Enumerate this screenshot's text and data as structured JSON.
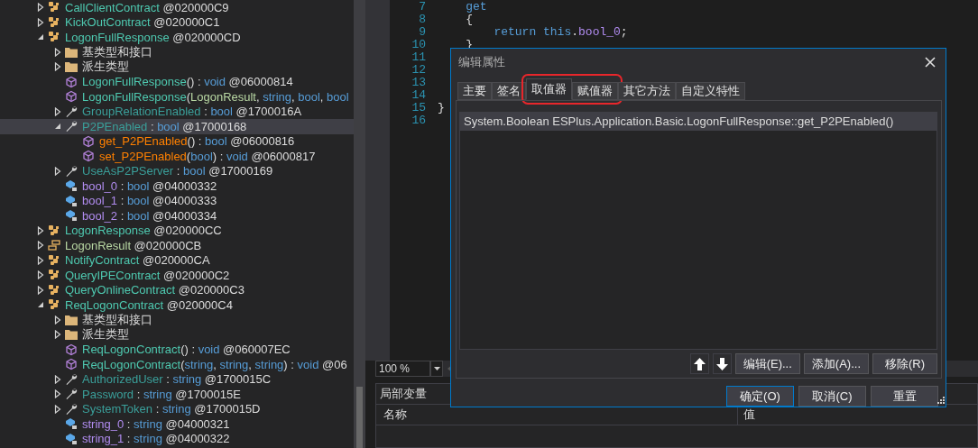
{
  "tree": {
    "items": [
      {
        "kind": "class",
        "expanded": false,
        "selected": false,
        "parts": [
          {
            "text": "CallClientContract",
            "kind": "type"
          },
          {
            "text": " @020000C9",
            "kind": "plain"
          }
        ]
      },
      {
        "kind": "class",
        "expanded": false,
        "selected": false,
        "parts": [
          {
            "text": "KickOutContract",
            "kind": "type"
          },
          {
            "text": " @020000C1",
            "kind": "plain"
          }
        ]
      },
      {
        "kind": "class",
        "expanded": true,
        "selected": false,
        "parts": [
          {
            "text": "LogonFullResponse",
            "kind": "type"
          },
          {
            "text": " @020000CD",
            "kind": "plain"
          }
        ],
        "children": [
          {
            "kind": "folder",
            "expanded": false,
            "selected": false,
            "parts": [
              {
                "text": "基类型和接口",
                "kind": "plain"
              }
            ]
          },
          {
            "kind": "folder",
            "expanded": false,
            "selected": false,
            "parts": [
              {
                "text": "派生类型",
                "kind": "plain"
              }
            ]
          },
          {
            "kind": "method",
            "selected": false,
            "parts": [
              {
                "text": "LogonFullResponse",
                "kind": "type"
              },
              {
                "text": "() : ",
                "kind": "plain"
              },
              {
                "text": "void",
                "kind": "keyword"
              },
              {
                "text": " @06000814",
                "kind": "plain"
              }
            ]
          },
          {
            "kind": "method",
            "selected": false,
            "parts": [
              {
                "text": "LogonFullResponse",
                "kind": "type"
              },
              {
                "text": "(",
                "kind": "plain"
              },
              {
                "text": "LogonResult",
                "kind": "enum"
              },
              {
                "text": ", ",
                "kind": "plain"
              },
              {
                "text": "string",
                "kind": "keyword"
              },
              {
                "text": ", ",
                "kind": "plain"
              },
              {
                "text": "bool",
                "kind": "keyword"
              },
              {
                "text": ", ",
                "kind": "plain"
              },
              {
                "text": "bool",
                "kind": "keyword"
              }
            ]
          },
          {
            "kind": "property",
            "expanded": false,
            "selected": false,
            "parts": [
              {
                "text": "GroupRelationEnabled",
                "kind": "property"
              },
              {
                "text": " : ",
                "kind": "plain"
              },
              {
                "text": "bool",
                "kind": "keyword"
              },
              {
                "text": " @1700016A",
                "kind": "plain"
              }
            ]
          },
          {
            "kind": "property",
            "expanded": true,
            "selected": true,
            "parts": [
              {
                "text": "P2PEnabled",
                "kind": "property"
              },
              {
                "text": " : ",
                "kind": "plain"
              },
              {
                "text": "bool",
                "kind": "keyword"
              },
              {
                "text": " @17000168",
                "kind": "plain"
              }
            ],
            "children": [
              {
                "kind": "method",
                "selected": false,
                "parts": [
                  {
                    "text": "get_P2PEnabled",
                    "kind": "accessor"
                  },
                  {
                    "text": "() : ",
                    "kind": "plain"
                  },
                  {
                    "text": "bool",
                    "kind": "keyword"
                  },
                  {
                    "text": " @06000816",
                    "kind": "plain"
                  }
                ]
              },
              {
                "kind": "method",
                "selected": false,
                "parts": [
                  {
                    "text": "set_P2PEnabled",
                    "kind": "accessor"
                  },
                  {
                    "text": "(",
                    "kind": "plain"
                  },
                  {
                    "text": "bool",
                    "kind": "keyword"
                  },
                  {
                    "text": ") : ",
                    "kind": "plain"
                  },
                  {
                    "text": "void",
                    "kind": "keyword"
                  },
                  {
                    "text": " @06000817",
                    "kind": "plain"
                  }
                ]
              }
            ]
          },
          {
            "kind": "property",
            "expanded": false,
            "selected": false,
            "parts": [
              {
                "text": "UseAsP2PServer",
                "kind": "property"
              },
              {
                "text": " : ",
                "kind": "plain"
              },
              {
                "text": "bool",
                "kind": "keyword"
              },
              {
                "text": " @17000169",
                "kind": "plain"
              }
            ]
          },
          {
            "kind": "field",
            "selected": false,
            "parts": [
              {
                "text": "bool_0",
                "kind": "field"
              },
              {
                "text": " : ",
                "kind": "plain"
              },
              {
                "text": "bool",
                "kind": "keyword"
              },
              {
                "text": " @04000332",
                "kind": "plain"
              }
            ]
          },
          {
            "kind": "field",
            "selected": false,
            "parts": [
              {
                "text": "bool_1",
                "kind": "field"
              },
              {
                "text": " : ",
                "kind": "plain"
              },
              {
                "text": "bool",
                "kind": "keyword"
              },
              {
                "text": " @04000333",
                "kind": "plain"
              }
            ]
          },
          {
            "kind": "field",
            "selected": false,
            "parts": [
              {
                "text": "bool_2",
                "kind": "field"
              },
              {
                "text": " : ",
                "kind": "plain"
              },
              {
                "text": "bool",
                "kind": "keyword"
              },
              {
                "text": " @04000334",
                "kind": "plain"
              }
            ]
          }
        ]
      },
      {
        "kind": "class",
        "expanded": false,
        "selected": false,
        "parts": [
          {
            "text": "LogonResponse",
            "kind": "type"
          },
          {
            "text": " @020000CC",
            "kind": "plain"
          }
        ]
      },
      {
        "kind": "enum",
        "expanded": false,
        "selected": false,
        "parts": [
          {
            "text": "LogonResult",
            "kind": "enum"
          },
          {
            "text": " @020000CB",
            "kind": "plain"
          }
        ]
      },
      {
        "kind": "class",
        "expanded": false,
        "selected": false,
        "parts": [
          {
            "text": "NotifyContract",
            "kind": "type"
          },
          {
            "text": " @020000CA",
            "kind": "plain"
          }
        ]
      },
      {
        "kind": "class",
        "expanded": false,
        "selected": false,
        "parts": [
          {
            "text": "QueryIPEContract",
            "kind": "type"
          },
          {
            "text": " @020000C2",
            "kind": "plain"
          }
        ]
      },
      {
        "kind": "class",
        "expanded": false,
        "selected": false,
        "parts": [
          {
            "text": "QueryOnlineContract",
            "kind": "type"
          },
          {
            "text": " @020000C3",
            "kind": "plain"
          }
        ]
      },
      {
        "kind": "class",
        "expanded": true,
        "selected": false,
        "parts": [
          {
            "text": "ReqLogonContract",
            "kind": "type"
          },
          {
            "text": " @020000C4",
            "kind": "plain"
          }
        ],
        "children": [
          {
            "kind": "folder",
            "expanded": false,
            "selected": false,
            "parts": [
              {
                "text": "基类型和接口",
                "kind": "plain"
              }
            ]
          },
          {
            "kind": "folder",
            "expanded": false,
            "selected": false,
            "parts": [
              {
                "text": "派生类型",
                "kind": "plain"
              }
            ]
          },
          {
            "kind": "method",
            "selected": false,
            "parts": [
              {
                "text": "ReqLogonContract",
                "kind": "type"
              },
              {
                "text": "() : ",
                "kind": "plain"
              },
              {
                "text": "void",
                "kind": "keyword"
              },
              {
                "text": " @060007EC",
                "kind": "plain"
              }
            ]
          },
          {
            "kind": "method",
            "selected": false,
            "parts": [
              {
                "text": "ReqLogonContract",
                "kind": "type"
              },
              {
                "text": "(",
                "kind": "plain"
              },
              {
                "text": "string",
                "kind": "keyword"
              },
              {
                "text": ", ",
                "kind": "plain"
              },
              {
                "text": "string",
                "kind": "keyword"
              },
              {
                "text": ", ",
                "kind": "plain"
              },
              {
                "text": "string",
                "kind": "keyword"
              },
              {
                "text": ") : ",
                "kind": "plain"
              },
              {
                "text": "void",
                "kind": "keyword"
              },
              {
                "text": " @06",
                "kind": "plain"
              }
            ]
          },
          {
            "kind": "property",
            "expanded": false,
            "selected": false,
            "parts": [
              {
                "text": "AuthorizedUser",
                "kind": "property"
              },
              {
                "text": " : ",
                "kind": "plain"
              },
              {
                "text": "string",
                "kind": "keyword"
              },
              {
                "text": " @1700015C",
                "kind": "plain"
              }
            ]
          },
          {
            "kind": "property",
            "expanded": false,
            "selected": false,
            "parts": [
              {
                "text": "Password",
                "kind": "property"
              },
              {
                "text": " : ",
                "kind": "plain"
              },
              {
                "text": "string",
                "kind": "keyword"
              },
              {
                "text": " @1700015E",
                "kind": "plain"
              }
            ]
          },
          {
            "kind": "property",
            "expanded": false,
            "selected": false,
            "parts": [
              {
                "text": "SystemToken",
                "kind": "property"
              },
              {
                "text": " : ",
                "kind": "plain"
              },
              {
                "text": "string",
                "kind": "keyword"
              },
              {
                "text": " @1700015D",
                "kind": "plain"
              }
            ]
          },
          {
            "kind": "field",
            "selected": false,
            "parts": [
              {
                "text": "string_0",
                "kind": "field"
              },
              {
                "text": " : ",
                "kind": "plain"
              },
              {
                "text": "string",
                "kind": "keyword"
              },
              {
                "text": " @04000321",
                "kind": "plain"
              }
            ]
          },
          {
            "kind": "field",
            "selected": false,
            "parts": [
              {
                "text": "string_1",
                "kind": "field"
              },
              {
                "text": " : ",
                "kind": "plain"
              },
              {
                "text": "string",
                "kind": "keyword"
              },
              {
                "text": " @04000322",
                "kind": "plain"
              }
            ]
          }
        ]
      }
    ]
  },
  "editor": {
    "lines": [
      {
        "number": "7",
        "parts": [
          {
            "text": "    get",
            "kind": "keyword"
          }
        ]
      },
      {
        "number": "8",
        "parts": [
          {
            "text": "    {",
            "kind": "plain"
          }
        ]
      },
      {
        "number": "9",
        "parts": [
          {
            "text": "        return this",
            "kind": "keyword"
          },
          {
            "text": ".",
            "kind": "plain"
          },
          {
            "text": "bool_0",
            "kind": "field"
          },
          {
            "text": ";",
            "kind": "plain"
          }
        ]
      },
      {
        "number": "10",
        "parts": [
          {
            "text": "    }",
            "kind": "plain"
          }
        ]
      },
      {
        "number": "11"
      },
      {
        "number": "12"
      },
      {
        "number": "13"
      },
      {
        "number": "14"
      },
      {
        "number": "15",
        "parts": [
          {
            "text": "}",
            "kind": "plain"
          }
        ]
      },
      {
        "number": "16"
      }
    ]
  },
  "zoom": {
    "value": "100 %"
  },
  "locals": {
    "title": "局部变量",
    "columns": [
      "名称",
      "值"
    ]
  },
  "dialog": {
    "title": "编辑属性",
    "tabs": [
      {
        "label": "主要",
        "selected": false,
        "highlighted": false
      },
      {
        "label": "签名",
        "selected": false,
        "highlighted": false
      },
      {
        "label": "取值器",
        "selected": true,
        "highlighted": true
      },
      {
        "label": "赋值器",
        "selected": false,
        "highlighted": true
      },
      {
        "label": "其它方法",
        "selected": false,
        "highlighted": false
      },
      {
        "label": "自定义特性",
        "selected": false,
        "highlighted": false
      }
    ],
    "items": [
      {
        "text": "System.Boolean ESPlus.Application.Basic.LogonFullResponse::get_P2PEnabled()",
        "selected": true
      }
    ],
    "list_buttons": [
      "编辑(E)...",
      "添加(A)...",
      "移除(R)"
    ],
    "buttons": [
      {
        "label": "确定(O)",
        "focused": true
      },
      {
        "label": "取消(C)",
        "focused": false
      },
      {
        "label": "重置",
        "focused": false
      }
    ]
  }
}
